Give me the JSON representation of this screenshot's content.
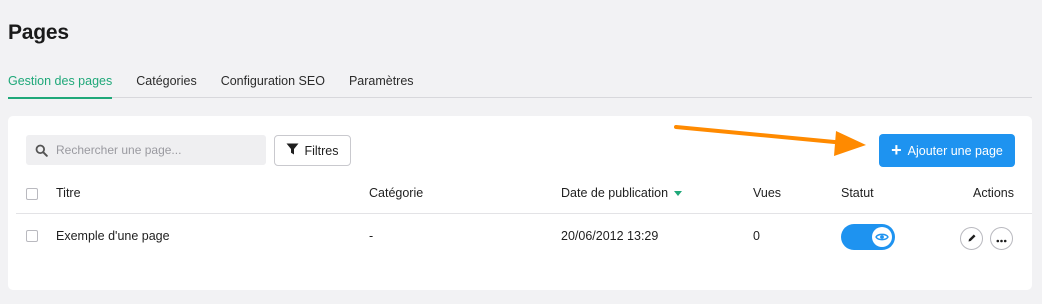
{
  "page": {
    "title": "Pages"
  },
  "tabs": [
    {
      "label": "Gestion des pages",
      "active": true
    },
    {
      "label": "Catégories"
    },
    {
      "label": "Configuration SEO"
    },
    {
      "label": "Paramètres"
    }
  ],
  "toolbar": {
    "search_placeholder": "Rechercher une page...",
    "filter_label": "Filtres",
    "add_label": "Ajouter une page"
  },
  "table": {
    "columns": {
      "title": "Titre",
      "category": "Catégorie",
      "published": "Date de publication",
      "views": "Vues",
      "status": "Statut",
      "actions": "Actions"
    },
    "rows": [
      {
        "title": "Exemple d'une page",
        "category": "-",
        "published": "20/06/2012 13:29",
        "views": "0",
        "status_visible": true
      }
    ]
  },
  "colors": {
    "accent_green": "#1fa879",
    "primary_blue": "#1e93f0",
    "annotation_orange": "#ff8a00"
  },
  "icons": [
    "search-icon",
    "filter-icon",
    "plus-icon",
    "sort-desc-icon",
    "eye-icon",
    "edit-icon",
    "more-icon",
    "annotation-arrow"
  ]
}
